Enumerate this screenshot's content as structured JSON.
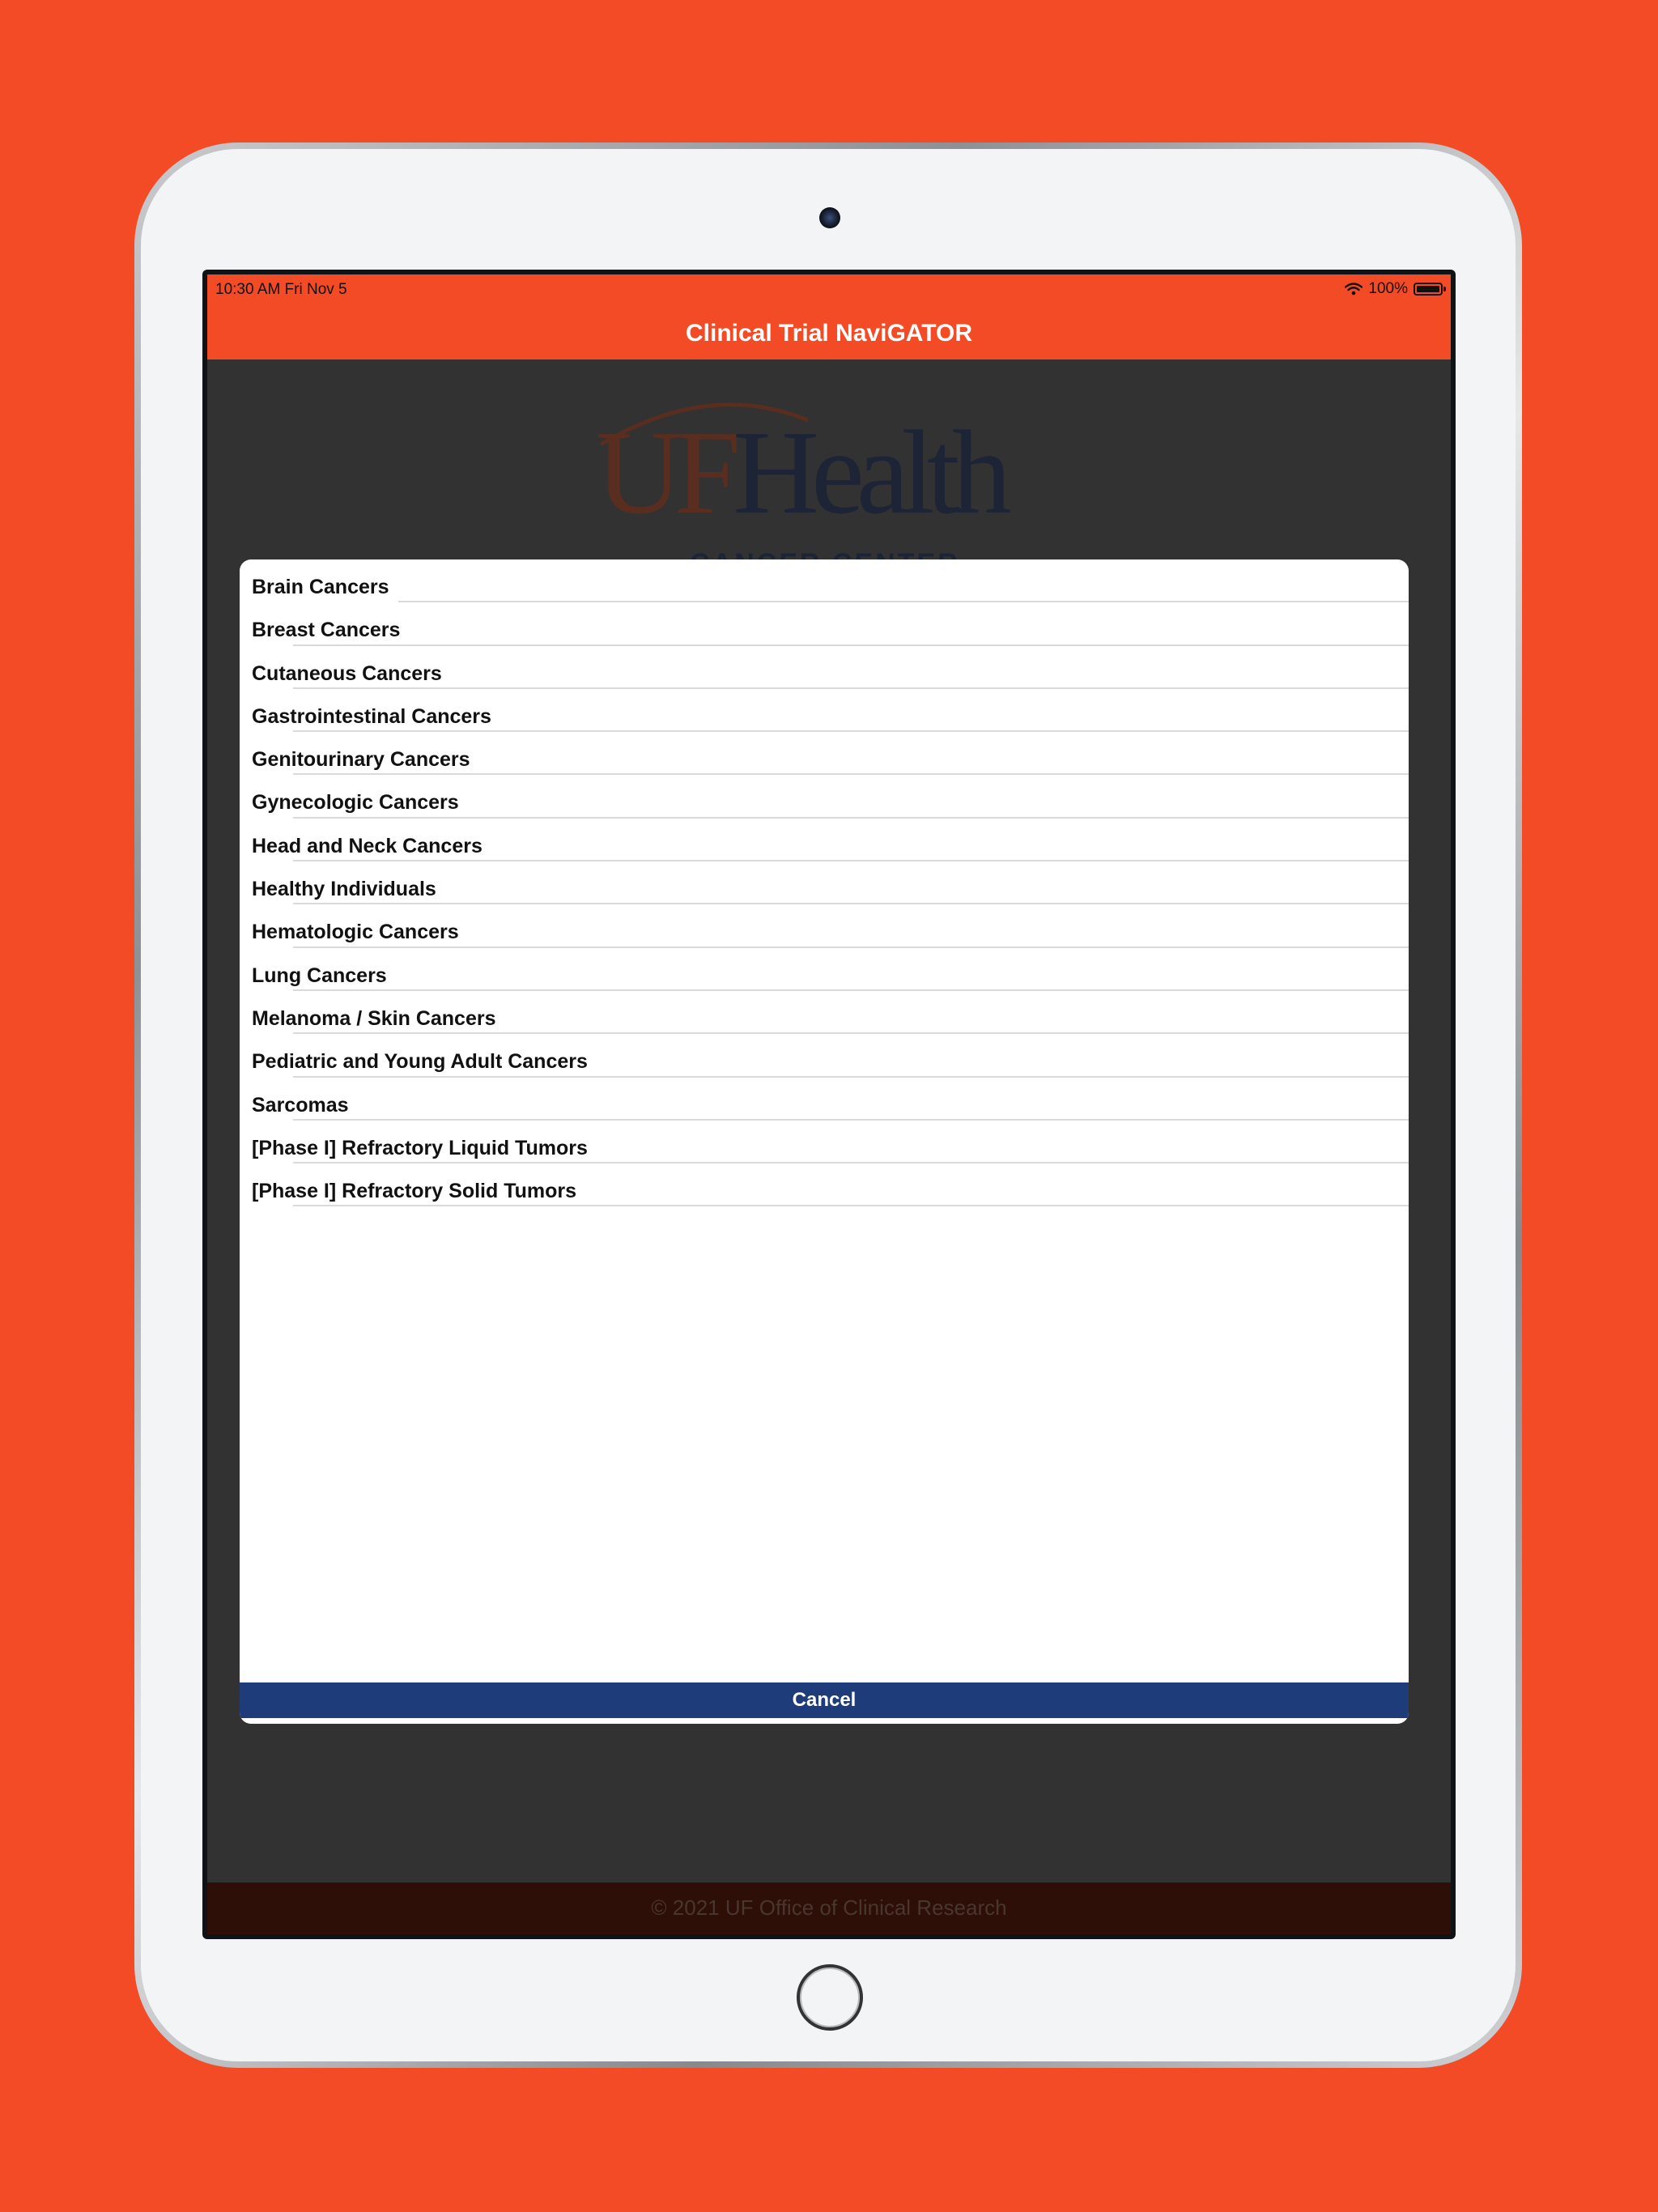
{
  "status_bar": {
    "time": "10:30 AM   Fri Nov 5",
    "battery": "100%"
  },
  "nav": {
    "title": "Clinical Trial NaviGATOR"
  },
  "logo": {
    "uf": "UF",
    "health": "Health",
    "subtitle": "CANCER CENTER"
  },
  "footer": {
    "text": "© 2021 UF Office of Clinical Research"
  },
  "modal": {
    "items": [
      {
        "label": "Brain Cancers"
      },
      {
        "label": "Breast Cancers"
      },
      {
        "label": "Cutaneous Cancers"
      },
      {
        "label": "Gastrointestinal Cancers"
      },
      {
        "label": "Genitourinary Cancers"
      },
      {
        "label": "Gynecologic Cancers"
      },
      {
        "label": "Head and Neck Cancers"
      },
      {
        "label": "Healthy Individuals"
      },
      {
        "label": "Hematologic Cancers"
      },
      {
        "label": "Lung Cancers"
      },
      {
        "label": "Melanoma / Skin Cancers"
      },
      {
        "label": "Pediatric and Young Adult Cancers"
      },
      {
        "label": "Sarcomas"
      },
      {
        "label": "[Phase I] Refractory Liquid Tumors"
      },
      {
        "label": "[Phase I] Refractory Solid Tumors"
      }
    ],
    "cancel_label": "Cancel"
  },
  "colors": {
    "background": "#f24b25",
    "nav_bar": "#f24b25",
    "overlay": "#323232",
    "cancel_button": "#1f3c7a",
    "footer": "#2e0f07"
  },
  "icons": {
    "wifi": "wifi-icon",
    "battery": "battery-icon",
    "camera": "camera-icon",
    "home": "home-button"
  }
}
